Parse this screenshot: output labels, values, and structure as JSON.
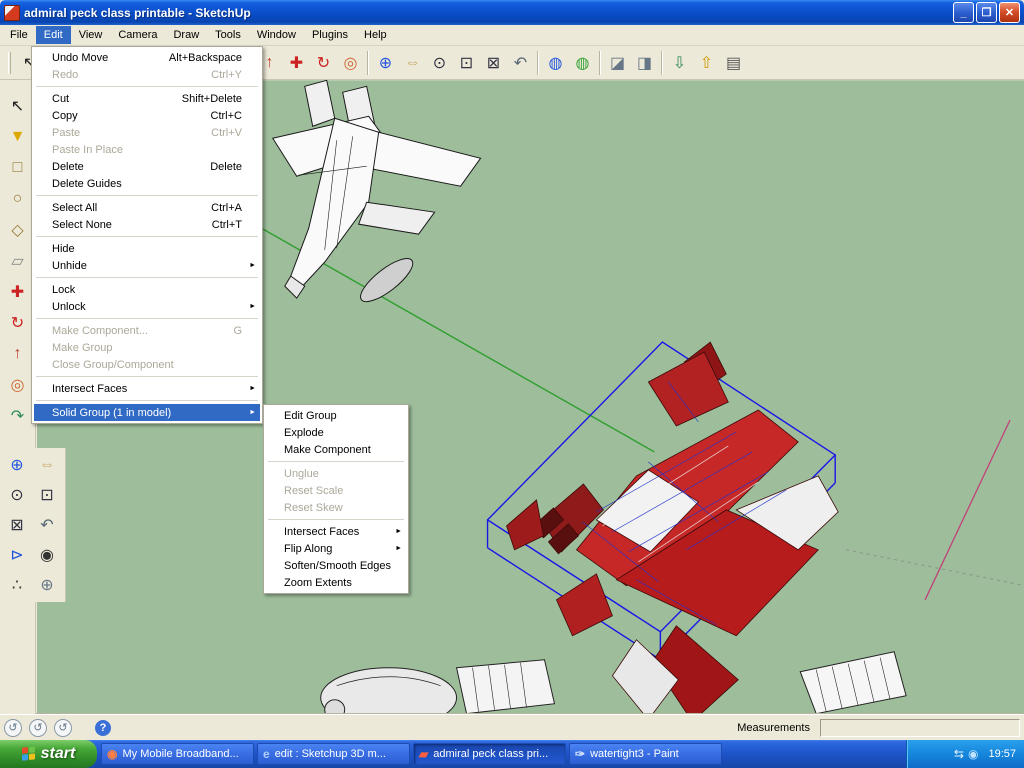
{
  "window": {
    "title": "admiral peck class printable - SketchUp"
  },
  "menu_bar": {
    "items": [
      {
        "label": "File"
      },
      {
        "label": "Edit",
        "active": true
      },
      {
        "label": "View"
      },
      {
        "label": "Camera"
      },
      {
        "label": "Draw"
      },
      {
        "label": "Tools"
      },
      {
        "label": "Window"
      },
      {
        "label": "Plugins"
      },
      {
        "label": "Help"
      }
    ]
  },
  "edit_menu": {
    "items": [
      {
        "label": "Undo Move",
        "shortcut": "Alt+Backspace"
      },
      {
        "label": "Redo",
        "shortcut": "Ctrl+Y",
        "enabled": false
      },
      {
        "separator": true
      },
      {
        "label": "Cut",
        "shortcut": "Shift+Delete"
      },
      {
        "label": "Copy",
        "shortcut": "Ctrl+C"
      },
      {
        "label": "Paste",
        "shortcut": "Ctrl+V",
        "enabled": false
      },
      {
        "label": "Paste In Place",
        "enabled": false
      },
      {
        "label": "Delete",
        "shortcut": "Delete"
      },
      {
        "label": "Delete Guides"
      },
      {
        "separator": true
      },
      {
        "label": "Select All",
        "shortcut": "Ctrl+A"
      },
      {
        "label": "Select None",
        "shortcut": "Ctrl+T"
      },
      {
        "separator": true
      },
      {
        "label": "Hide"
      },
      {
        "label": "Unhide",
        "submenu": true
      },
      {
        "separator": true
      },
      {
        "label": "Lock"
      },
      {
        "label": "Unlock",
        "submenu": true
      },
      {
        "separator": true
      },
      {
        "label": "Make Component...",
        "shortcut": "G",
        "enabled": false
      },
      {
        "label": "Make Group",
        "enabled": false
      },
      {
        "label": "Close Group/Component",
        "enabled": false
      },
      {
        "separator": true
      },
      {
        "label": "Intersect Faces",
        "submenu": true
      },
      {
        "separator": true
      },
      {
        "label": "Solid Group (1 in model)",
        "submenu": true,
        "highlighted": true
      }
    ]
  },
  "solid_group_submenu": {
    "items": [
      {
        "label": "Edit Group"
      },
      {
        "label": "Explode"
      },
      {
        "label": "Make Component"
      },
      {
        "separator": true
      },
      {
        "label": "Unglue",
        "enabled": false
      },
      {
        "label": "Reset Scale",
        "enabled": false
      },
      {
        "label": "Reset Skew",
        "enabled": false
      },
      {
        "separator": true
      },
      {
        "label": "Intersect Faces",
        "submenu": true
      },
      {
        "label": "Flip Along",
        "submenu": true
      },
      {
        "label": "Soften/Smooth Edges"
      },
      {
        "label": "Zoom Extents"
      }
    ]
  },
  "toolbar": {
    "icons": [
      {
        "name": "select",
        "glyph": "↖",
        "color": "#222222"
      },
      {
        "name": "line",
        "glyph": "✎",
        "color": "#222222"
      },
      {
        "name": "rectangle",
        "glyph": "□",
        "color": "#9a7b3a"
      },
      {
        "name": "circle",
        "glyph": "○",
        "color": "#9a7b3a"
      },
      {
        "name": "arc",
        "glyph": "⌒",
        "color": "#9a7b3a"
      },
      {
        "sep": true
      },
      {
        "name": "eraser",
        "glyph": "▱",
        "color": "#aa4466"
      },
      {
        "name": "tape-measure",
        "glyph": "⊢",
        "color": "#445566"
      },
      {
        "sep": true
      },
      {
        "name": "paint-bucket",
        "glyph": "▼",
        "color": "#dda800"
      },
      {
        "sep": true
      },
      {
        "name": "push-pull",
        "glyph": "↑",
        "color": "#c03a2b"
      },
      {
        "name": "move",
        "glyph": "✚",
        "color": "#cc2222"
      },
      {
        "name": "rotate",
        "glyph": "↻",
        "color": "#cc2222"
      },
      {
        "name": "offset",
        "glyph": "◎",
        "color": "#cc6633"
      },
      {
        "sep": true
      },
      {
        "name": "orbit",
        "glyph": "⊕",
        "color": "#2255dd"
      },
      {
        "name": "pan",
        "glyph": "⇔",
        "color": "#c9a86a"
      },
      {
        "name": "zoom",
        "glyph": "⊙",
        "color": "#333344"
      },
      {
        "name": "zoom-window",
        "glyph": "⊡",
        "color": "#333344"
      },
      {
        "name": "zoom-extents",
        "glyph": "⊠",
        "color": "#333344"
      },
      {
        "name": "previous-view",
        "glyph": "↶",
        "color": "#556677"
      },
      {
        "sep": true
      },
      {
        "name": "get-models",
        "glyph": "◍",
        "color": "#2255dd"
      },
      {
        "name": "share-model",
        "glyph": "◍",
        "color": "#33a033"
      },
      {
        "sep": true
      },
      {
        "name": "section-plane",
        "glyph": "◪",
        "color": "#667788"
      },
      {
        "name": "section-display",
        "glyph": "◨",
        "color": "#667788"
      },
      {
        "sep": true
      },
      {
        "name": "import",
        "glyph": "⇩",
        "color": "#2e8b57"
      },
      {
        "name": "export",
        "glyph": "⇧",
        "color": "#cc9900"
      },
      {
        "name": "print",
        "glyph": "▤",
        "color": "#555555"
      }
    ]
  },
  "left_toolbar": {
    "singles": [
      {
        "name": "select",
        "glyph": "↖",
        "color": "#222222"
      },
      {
        "name": "paint-bucket",
        "glyph": "▼",
        "color": "#dda800"
      },
      {
        "name": "rectangle",
        "glyph": "□",
        "color": "#9a7b3a"
      },
      {
        "name": "circle",
        "glyph": "○",
        "color": "#9a7b3a"
      },
      {
        "name": "polygon",
        "glyph": "◇",
        "color": "#9a7b3a"
      },
      {
        "name": "eraser",
        "glyph": "▱",
        "color": "#888888"
      },
      {
        "name": "move",
        "glyph": "✚",
        "color": "#cc2222"
      },
      {
        "name": "rotate",
        "glyph": "↻",
        "color": "#cc2222"
      },
      {
        "name": "push-pull",
        "glyph": "↑",
        "color": "#c03a2b"
      },
      {
        "name": "offset",
        "glyph": "◎",
        "color": "#cc6633"
      },
      {
        "name": "follow-me",
        "glyph": "↷",
        "color": "#2e8b57"
      }
    ],
    "pairs": [
      {
        "name": "orbit",
        "glyph": "⊕",
        "color": "#2255dd"
      },
      {
        "name": "pan",
        "glyph": "⇔",
        "color": "#c9a86a"
      },
      {
        "name": "zoom",
        "glyph": "⊙",
        "color": "#333344"
      },
      {
        "name": "zoom-window",
        "glyph": "⊡",
        "color": "#333344"
      },
      {
        "name": "zoom-extents",
        "glyph": "⊠",
        "color": "#333344"
      },
      {
        "name": "previous-view",
        "glyph": "↶",
        "color": "#556677"
      },
      {
        "name": "position-camera",
        "glyph": "⊳",
        "color": "#2255dd"
      },
      {
        "name": "look-around",
        "glyph": "◉",
        "color": "#333333"
      },
      {
        "name": "walk",
        "glyph": "∴",
        "color": "#333333"
      },
      {
        "name": "field-of-view",
        "glyph": "⊕",
        "color": "#667788"
      }
    ]
  },
  "canvas": {
    "bg": "#9ebe9b",
    "selection_color": "#1717e8",
    "ship_red": "#c62828",
    "axis_green": "#2e9e2e",
    "axis_red": "#c2407a"
  },
  "status_bar": {
    "icons": [
      {
        "name": "status-circle-1",
        "glyph": "↺",
        "color": "#667788"
      },
      {
        "name": "status-circle-2",
        "glyph": "↺",
        "color": "#667788"
      },
      {
        "name": "status-circle-3",
        "glyph": "↺",
        "color": "#667788"
      }
    ],
    "help_glyph": "?",
    "measurements_label": "Measurements"
  },
  "taskbar": {
    "start_label": "start",
    "time": "19:57",
    "items": [
      {
        "label": "My Mobile Broadband...",
        "icon": "mobile-broadband",
        "glyph": "◉",
        "color": "#ff8040",
        "active": false
      },
      {
        "label": "edit : Sketchup 3D m...",
        "icon": "internet-explorer",
        "glyph": "e",
        "color": "#aecff5",
        "active": false
      },
      {
        "label": "admiral peck class pri...",
        "icon": "sketchup",
        "glyph": "▰",
        "color": "#ff6040",
        "active": true
      },
      {
        "label": "watertight3 - Paint",
        "icon": "paint",
        "glyph": "✑",
        "color": "#cfe0ff",
        "active": false
      }
    ],
    "tray_icons": [
      {
        "name": "network",
        "glyph": "⇆",
        "color": "#eaf4ff"
      },
      {
        "name": "connection",
        "glyph": "◉",
        "color": "#bfe3ff"
      }
    ]
  }
}
